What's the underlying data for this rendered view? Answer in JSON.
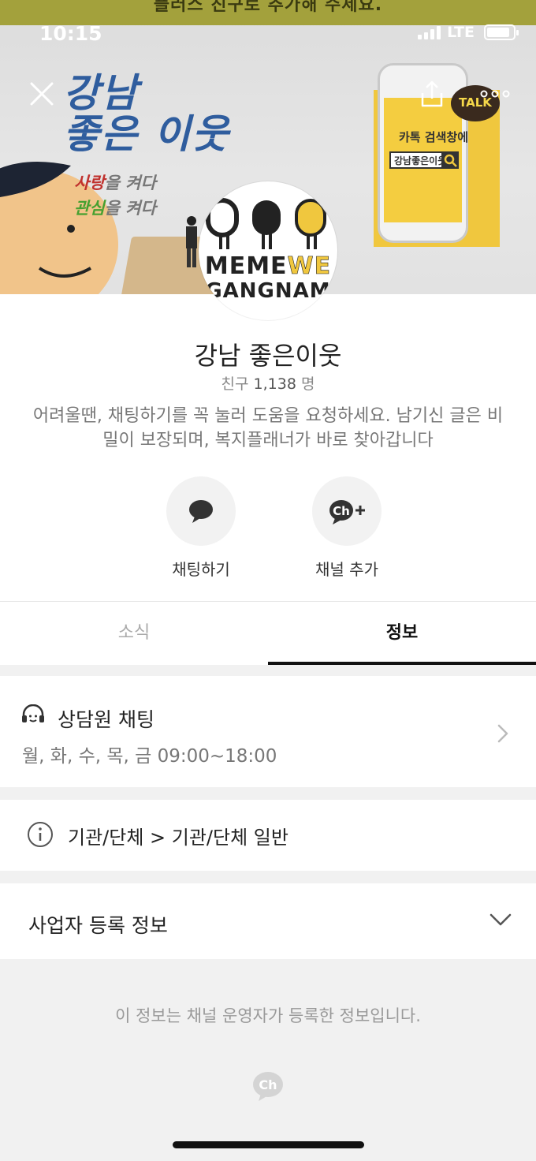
{
  "status_bar": {
    "time": "10:15",
    "network": "LTE"
  },
  "banner": {
    "top_strip_text": "플러스 친구로 추가해 주세요.",
    "title_line1": "강남",
    "title_line2": "좋은 이웃",
    "slogan1_highlight": "사랑",
    "slogan1_rest": "을 켜다",
    "slogan2_highlight": "관심",
    "slogan2_rest": "을 켜다",
    "phone_caption": "카톡 검색창에",
    "phone_search": "강남좋은이웃",
    "talk_badge": "TALK",
    "accent_color": "#f0c73e"
  },
  "profile": {
    "logo_line1_a": "MEME",
    "logo_line1_b": "WE",
    "logo_line2": "GANGNAM",
    "name": "강남 좋은이웃",
    "friends_label": "친구",
    "friends_count": "1,138",
    "friends_unit": "명",
    "description": "어려울땐, 채팅하기를 꼭 눌러 도움을 요청하세요. 남기신 글은 비밀이 보장되며, 복지플래너가 바로 찾아갑니다"
  },
  "actions": {
    "chat_label": "채팅하기",
    "add_label": "채널 추가",
    "add_icon_text": "Ch"
  },
  "tabs": {
    "news": "소식",
    "info": "정보",
    "active": "info"
  },
  "info": {
    "counsel_title": "상담원 채팅",
    "counsel_hours": "월, 화, 수, 목, 금  09:00~18:00",
    "category": "기관/단체 > 기관/단체 일반",
    "business_info": "사업자 등록 정보",
    "footer_note": "이 정보는 채널 운영자가 등록한 정보입니다.",
    "footer_badge": "Ch"
  },
  "icons": {
    "close": "close-icon",
    "share": "share-icon",
    "more": "more-icon",
    "chat": "chat-bubble-icon",
    "add_channel": "channel-add-icon",
    "counsel": "headset-icon",
    "info": "info-icon",
    "chevron_right": "chevron-right-icon",
    "chevron_down": "chevron-down-icon"
  }
}
